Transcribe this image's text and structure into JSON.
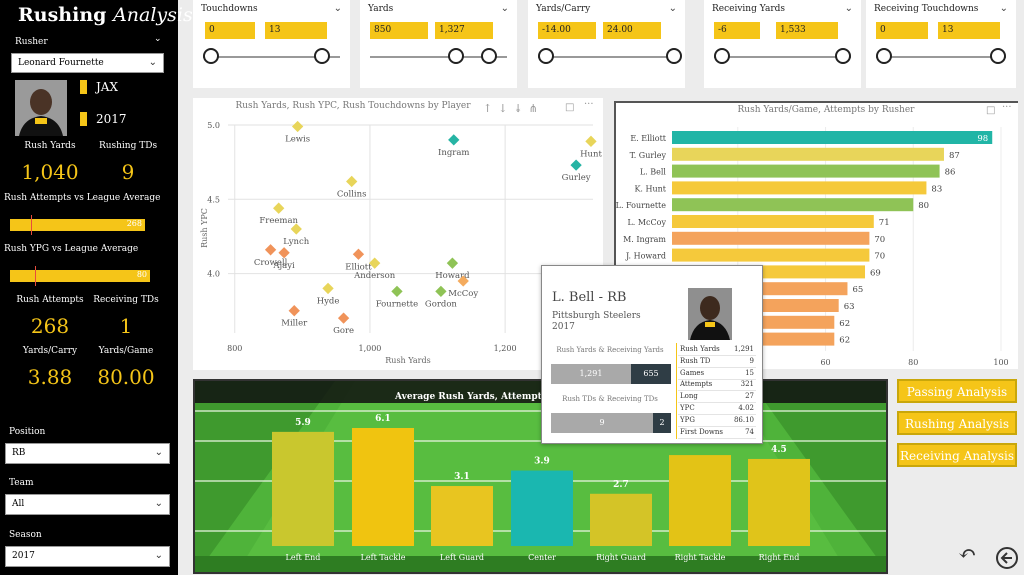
{
  "sidebar": {
    "title_main": "Rushing",
    "title_sub": "Analysis",
    "rusher_label": "Rusher",
    "rusher_value": "Leonard Fournette",
    "team_abbr": "JAX",
    "season_badge": "2017",
    "stats_top": [
      {
        "label": "Rush Yards",
        "value": "1,040"
      },
      {
        "label": "Rushing TDs",
        "value": "9"
      }
    ],
    "attempts_vs_league_label": "Rush Attempts vs League Average",
    "attempts_vs_league_value": "268",
    "attempts_vs_league_fill": 0.78,
    "ypg_vs_league_label": "Rush YPG vs League Average",
    "ypg_vs_league_value": "80",
    "ypg_vs_league_fill": 0.82,
    "stats_bottom": [
      {
        "label": "Rush Attempts",
        "value": "268"
      },
      {
        "label": "Receiving TDs",
        "value": "1"
      },
      {
        "label": "Yards/Carry",
        "value": "3.88"
      },
      {
        "label": "Yards/Game",
        "value": "80.00"
      }
    ],
    "filters": [
      {
        "label": "Position",
        "value": "RB"
      },
      {
        "label": "Team",
        "value": "All"
      },
      {
        "label": "Season",
        "value": "2017"
      }
    ]
  },
  "slicers": [
    {
      "title": "Touchdowns",
      "min": "0",
      "max": "13"
    },
    {
      "title": "Yards",
      "min": "850",
      "max": "1,327"
    },
    {
      "title": "Yards/Carry",
      "min": "-14.00",
      "max": "24.00"
    },
    {
      "title": "Receiving Yards",
      "min": "-6",
      "max": "1,533"
    },
    {
      "title": "Receiving Touchdowns",
      "min": "0",
      "max": "13"
    }
  ],
  "scatter": {
    "title": "Rush Yards, Rush YPC, Rush Touchdowns by Player",
    "xlabel": "Rush Yards",
    "ylabel": "Rush YPC",
    "x_ticks": [
      "800",
      "1,000",
      "1,200"
    ],
    "y_ticks": [
      "5.0",
      "4.5",
      "4.0"
    ],
    "colors": {
      "yellow": "#e8d55a",
      "green": "#8fc356",
      "teal": "#26b4a4",
      "orange": "#f0935a",
      "lightorange": "#f4ab5e"
    }
  },
  "bar_rusher": {
    "title": "Rush Yards/Game, Attempts by Rusher",
    "x_ticks": [
      "40",
      "60",
      "80",
      "100"
    ]
  },
  "tooltip": {
    "name": "L. Bell - RB",
    "team": "Pittsburgh Steelers",
    "season": "2017",
    "rr_title": "Rush Yards & Receiving Yards",
    "rr_left": "1,291",
    "rr_right": "655",
    "td_title": "Rush TDs & Receiving TDs",
    "td_left": "9",
    "td_right": "2",
    "rows": [
      {
        "k": "Rush Yards",
        "v": "1,291"
      },
      {
        "k": "Rush TD",
        "v": "9"
      },
      {
        "k": "Games",
        "v": "15"
      },
      {
        "k": "Attempts",
        "v": "321"
      },
      {
        "k": "Long",
        "v": "27"
      },
      {
        "k": "YPC",
        "v": "4.02"
      },
      {
        "k": "YPG",
        "v": "86.10"
      },
      {
        "k": "First Downs",
        "v": "74"
      }
    ]
  },
  "field_chart": {
    "title": "Average Rush Yards, Attempt"
  },
  "nav": {
    "passing": "Passing Analysis",
    "rushing": "Rushing Analysis",
    "receiving": "Receiving Analysis"
  },
  "chart_data": [
    {
      "type": "scatter",
      "title": "Rush Yards, Rush YPC, Rush Touchdowns by Player",
      "xlabel": "Rush Yards",
      "ylabel": "Rush YPC",
      "xlim": [
        790,
        1330
      ],
      "ylim": [
        3.6,
        5.0
      ],
      "points": [
        {
          "label": "Lewis",
          "x": 893,
          "y": 4.99,
          "color": "yellow"
        },
        {
          "label": "Ingram",
          "x": 1124,
          "y": 4.9,
          "color": "teal"
        },
        {
          "label": "Hunt",
          "x": 1327,
          "y": 4.89,
          "color": "yellow"
        },
        {
          "label": "Gurley",
          "x": 1305,
          "y": 4.73,
          "color": "teal"
        },
        {
          "label": "Collins",
          "x": 973,
          "y": 4.62,
          "color": "yellow"
        },
        {
          "label": "Freeman",
          "x": 865,
          "y": 4.44,
          "color": "yellow"
        },
        {
          "label": "Lynch",
          "x": 891,
          "y": 4.3,
          "color": "yellow"
        },
        {
          "label": "Crowell",
          "x": 853,
          "y": 4.16,
          "color": "orange"
        },
        {
          "label": "Ajayi",
          "x": 873,
          "y": 4.14,
          "color": "orange"
        },
        {
          "label": "Elliott",
          "x": 983,
          "y": 4.13,
          "color": "orange"
        },
        {
          "label": "Anderson",
          "x": 1007,
          "y": 4.07,
          "color": "yellow"
        },
        {
          "label": "Howard",
          "x": 1122,
          "y": 4.07,
          "color": "green"
        },
        {
          "label": "Bell",
          "x": 1291,
          "y": 4.02,
          "color": "green"
        },
        {
          "label": "Hyde",
          "x": 938,
          "y": 3.9,
          "color": "yellow"
        },
        {
          "label": "McCoy",
          "x": 1138,
          "y": 3.95,
          "color": "lightorange"
        },
        {
          "label": "Gordon",
          "x": 1105,
          "y": 3.88,
          "color": "green"
        },
        {
          "label": "Fournette",
          "x": 1040,
          "y": 3.88,
          "color": "green"
        },
        {
          "label": "Miller",
          "x": 888,
          "y": 3.75,
          "color": "orange"
        },
        {
          "label": "Gore",
          "x": 961,
          "y": 3.7,
          "color": "orange"
        }
      ]
    },
    {
      "type": "bar",
      "orientation": "horizontal",
      "title": "Rush Yards/Game, Attempts by Rusher",
      "xlim": [
        25,
        100
      ],
      "categories": [
        "E. Elliott",
        "T. Gurley",
        "L. Bell",
        "K. Hunt",
        "L. Fournette",
        "L. McCoy",
        "M. Ingram",
        "J. Howard",
        "",
        "",
        "",
        "",
        ""
      ],
      "values": [
        98,
        87,
        86,
        83,
        80,
        71,
        70,
        70,
        69,
        65,
        63,
        62,
        62
      ],
      "colors": [
        "#21b5a6",
        "#e8d55a",
        "#8fc356",
        "#f5c93b",
        "#8fc356",
        "#f5c93b",
        "#f4a35c",
        "#f5c93b",
        "#f5c93b",
        "#f4a35c",
        "#f4a35c",
        "#f4a35c",
        "#f4a35c"
      ]
    },
    {
      "type": "bar",
      "title": "Average Rush Yards, Attempt",
      "categories": [
        "Left End",
        "Left Tackle",
        "Left Guard",
        "Center",
        "Right Guard",
        "Right Tackle",
        "Right End"
      ],
      "values": [
        5.9,
        6.1,
        3.1,
        3.9,
        2.7,
        null,
        4.5
      ],
      "value_labels": [
        "5.9",
        "6.1",
        "3.1",
        "3.9",
        "2.7",
        "",
        "4.5"
      ],
      "bar_heights_relative": [
        5.9,
        6.1,
        3.1,
        3.9,
        2.7,
        4.7,
        4.5
      ],
      "colors": [
        "#c9c72e",
        "#f0c410",
        "#e8c520",
        "#1ab7b0",
        "#d4c427",
        "#e3c316",
        "#e0c41a"
      ]
    }
  ]
}
